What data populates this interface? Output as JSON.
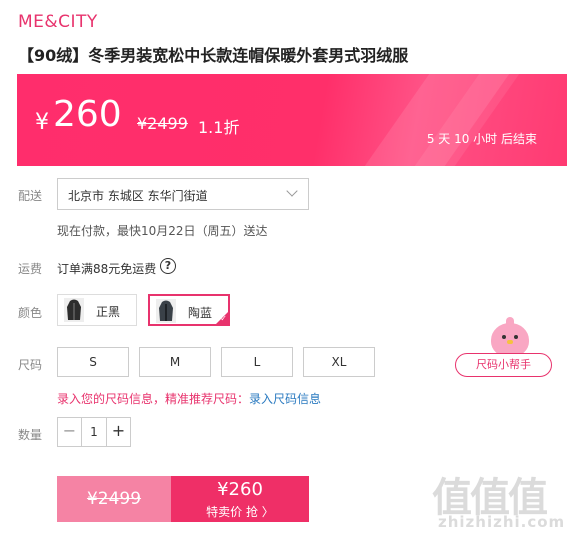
{
  "brand": "ME&CITY",
  "product_title": "【90绒】冬季男装宽松中长款连帽保暖外套男式羽绒服",
  "price_banner": {
    "currency": "¥",
    "price": "260",
    "original_price": "¥2499",
    "discount": "1.1折",
    "countdown": "5 天 10 小时 后结束",
    "color": "#ff2d6c"
  },
  "delivery": {
    "label": "配送",
    "address": "北京市 东城区 东华门街道",
    "estimate": "现在付款，最快10月22日（周五）送达"
  },
  "shipping": {
    "label": "运费",
    "text": "订单满88元免运费",
    "help_icon": "?"
  },
  "color": {
    "label": "颜色",
    "options": [
      {
        "name": "正黑",
        "selected": false
      },
      {
        "name": "陶蓝",
        "selected": true
      }
    ]
  },
  "size": {
    "label": "尺码",
    "options": [
      "S",
      "M",
      "L",
      "XL"
    ],
    "helper": "尺码小帮手",
    "tip_prefix": "录入您的尺码信息，精准推荐尺码：",
    "tip_link": "录入尺码信息"
  },
  "quantity": {
    "label": "数量",
    "value": "1",
    "minus": "−",
    "plus": "+"
  },
  "buy": {
    "original_price": "¥2499",
    "price": "¥260",
    "cta": "特卖价 抢 〉"
  },
  "watermark": {
    "glyphs": "值值值",
    "domain": "zhizhizhi.com"
  },
  "accent_color": "#e8336d"
}
